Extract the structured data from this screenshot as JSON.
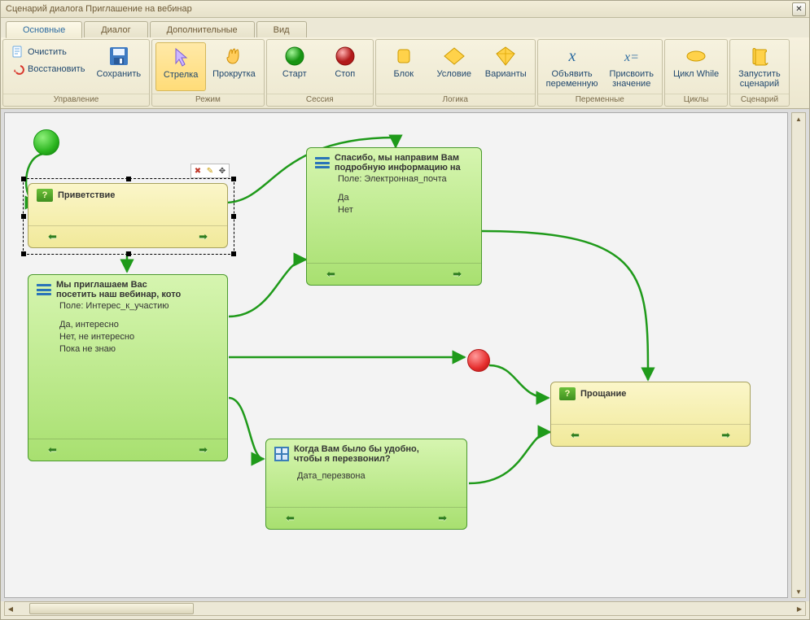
{
  "window": {
    "title": "Сценарий диалога Приглашение на вебинар"
  },
  "tabs": [
    {
      "label": "Основные",
      "active": true
    },
    {
      "label": "Диалог"
    },
    {
      "label": "Дополнительные"
    },
    {
      "label": "Вид"
    }
  ],
  "ribbon": {
    "groups": [
      {
        "name": "management",
        "label": "Управление",
        "layout": "list",
        "items": [
          {
            "name": "clear-button",
            "icon": "page-clear",
            "label": "Очистить"
          },
          {
            "name": "restore-button",
            "icon": "undo-red",
            "label": "Восстановить"
          }
        ]
      },
      {
        "name": "save-group",
        "label": "",
        "layout": "big",
        "items": [
          {
            "name": "save-button",
            "icon": "disk",
            "label": "Сохранить"
          }
        ]
      },
      {
        "name": "mode",
        "label": "Режим",
        "layout": "big",
        "items": [
          {
            "name": "arrow-button",
            "icon": "cursor",
            "label": "Стрелка",
            "active": true
          },
          {
            "name": "scroll-button",
            "icon": "hand",
            "label": "Прокрутка"
          }
        ]
      },
      {
        "name": "session",
        "label": "Сессия",
        "layout": "big",
        "items": [
          {
            "name": "start-button",
            "icon": "ball-green",
            "label": "Старт"
          },
          {
            "name": "stop-button",
            "icon": "ball-red",
            "label": "Стоп"
          }
        ]
      },
      {
        "name": "logic",
        "label": "Логика",
        "layout": "big",
        "items": [
          {
            "name": "block-button",
            "icon": "rect-yellow",
            "label": "Блок"
          },
          {
            "name": "condition-button",
            "icon": "diamond-yellow",
            "label": "Условие"
          },
          {
            "name": "variants-button",
            "icon": "diamond-3d",
            "label": "Варианты"
          }
        ]
      },
      {
        "name": "variables",
        "label": "Переменные",
        "layout": "big",
        "items": [
          {
            "name": "declare-var-button",
            "icon": "x-blue",
            "label": "Объявить\nпеременную"
          },
          {
            "name": "assign-val-button",
            "icon": "x-equals",
            "label": "Присвоить\nзначение"
          }
        ]
      },
      {
        "name": "loops",
        "label": "Циклы",
        "layout": "big",
        "items": [
          {
            "name": "while-button",
            "icon": "oval-yellow",
            "label": "Цикл While"
          }
        ]
      },
      {
        "name": "scenario",
        "label": "Сценарий",
        "layout": "big",
        "items": [
          {
            "name": "run-scenario-button",
            "icon": "scroll-yellow",
            "label": "Запустить\nсценарий"
          }
        ]
      }
    ]
  },
  "canvas": {
    "nodes": {
      "greeting": {
        "title": "Приветствие"
      },
      "invite": {
        "title_line1": "Мы приглашаем Вас",
        "title_line2": "посетить наш вебинар, кото",
        "field": "Поле: Интерес_к_участию",
        "options": [
          "Да, интересно",
          "Нет, не интересно",
          "Пока не знаю"
        ]
      },
      "thanks": {
        "title_line1": "Спасибо, мы направим Вам",
        "title_line2": "подробную информацию на",
        "field": "Поле: Электронная_почта",
        "options": [
          "Да",
          "Нет"
        ]
      },
      "callback": {
        "title_line1": "Когда Вам было бы удобно,",
        "title_line2": "чтобы я перезвонил?",
        "body": "Дата_перезвона"
      },
      "farewell": {
        "title": "Прощание"
      }
    },
    "mini_toolbar": {
      "items": [
        "delete",
        "edit",
        "move"
      ]
    }
  }
}
